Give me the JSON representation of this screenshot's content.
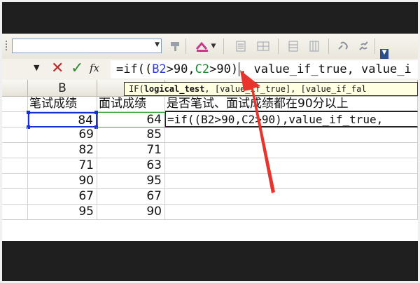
{
  "toolbar": {
    "icons": [
      "format-painter-icon",
      "highlight-color-icon",
      "dropdown-icon",
      "align-left-icon",
      "merge-cells-icon",
      "border-icon",
      "table-icon",
      "link-icon",
      "unlink-icon"
    ]
  },
  "formula_bar": {
    "cancel_icon": "✕",
    "enter_icon": "✓",
    "fx_label": "fx",
    "formula_prefix": "=if((",
    "ref_b2": "B2",
    "mid1": ">90,",
    "ref_c2": "C2",
    "mid2": ">90)",
    "formula_suffix": ", value_if_true, value_i"
  },
  "tooltip": {
    "fn": "IF(",
    "arg_bold": "logical_test",
    "rest": ", [value_if_true], [value_if_fal"
  },
  "grid": {
    "col_b_header": "B",
    "header_row": {
      "b": "笔试成绩",
      "c": "面试成绩",
      "d": "是否笔试、面试成绩都在90分以上"
    },
    "active_formula": "=if((B2>90,C2>90),value_if_true,",
    "rows": [
      {
        "b": "84",
        "c": "64"
      },
      {
        "b": "69",
        "c": "85"
      },
      {
        "b": "82",
        "c": "71"
      },
      {
        "b": "71",
        "c": "63"
      },
      {
        "b": "90",
        "c": "95"
      },
      {
        "b": "67",
        "c": "67"
      },
      {
        "b": "95",
        "c": "90"
      }
    ]
  },
  "colors": {
    "arrow": "#e8342c",
    "ref_b2": "#2a3bd6",
    "ref_c2": "#1f8a35",
    "selection": "#1a2fd0"
  }
}
